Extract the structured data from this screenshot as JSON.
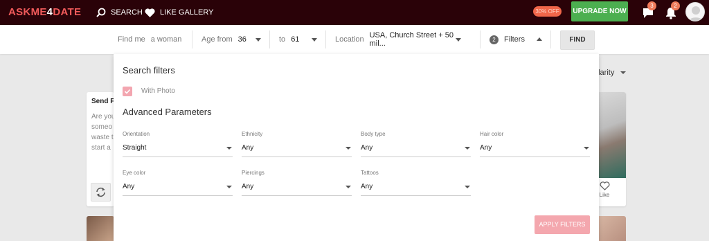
{
  "brand": {
    "logo_part1": "ASKME",
    "logo_num": "4",
    "logo_part2": "DATE"
  },
  "nav": {
    "search_label": "SEARCH",
    "gallery_label": "LIKE GALLERY"
  },
  "promo": {
    "discount_badge": "30% OFF",
    "upgrade_label": "UPGRADE NOW"
  },
  "notifications": {
    "messages_count": "3",
    "alerts_count": "2"
  },
  "searchbar": {
    "find_me_label": "Find me",
    "find_me_value": "a woman",
    "age_from_label": "Age from",
    "age_from_value": "36",
    "age_to_label": "to",
    "age_to_value": "61",
    "location_label": "Location",
    "location_value": "USA, Church Street + 50 mil...",
    "filters_count": "2",
    "filters_label": "Filters",
    "find_label": "FIND"
  },
  "background": {
    "sort_label_partial": "ularity",
    "left_card_title": "Send Fl",
    "left_card_lines": [
      "Are you",
      "someo",
      "waste t",
      "start a"
    ],
    "like_label": "Like"
  },
  "filters_panel": {
    "title": "Search filters",
    "with_photo_label": "With Photo",
    "with_photo_checked": true,
    "advanced_title": "Advanced Parameters",
    "fields": [
      {
        "label": "Orientation",
        "value": "Straight"
      },
      {
        "label": "Ethnicity",
        "value": "Any"
      },
      {
        "label": "Body type",
        "value": "Any"
      },
      {
        "label": "Hair color",
        "value": "Any"
      },
      {
        "label": "Eye color",
        "value": "Any"
      },
      {
        "label": "Piercings",
        "value": "Any"
      },
      {
        "label": "Tattoos",
        "value": "Any"
      }
    ],
    "apply_label": "APPLY FILTERS"
  },
  "colors": {
    "topbar": "#2a0208",
    "logo": "#f05a5a",
    "upgrade": "#4caf50",
    "badge": "#f0664a",
    "apply": "#f4a7ae",
    "checkbox": "#f3a6b0"
  }
}
